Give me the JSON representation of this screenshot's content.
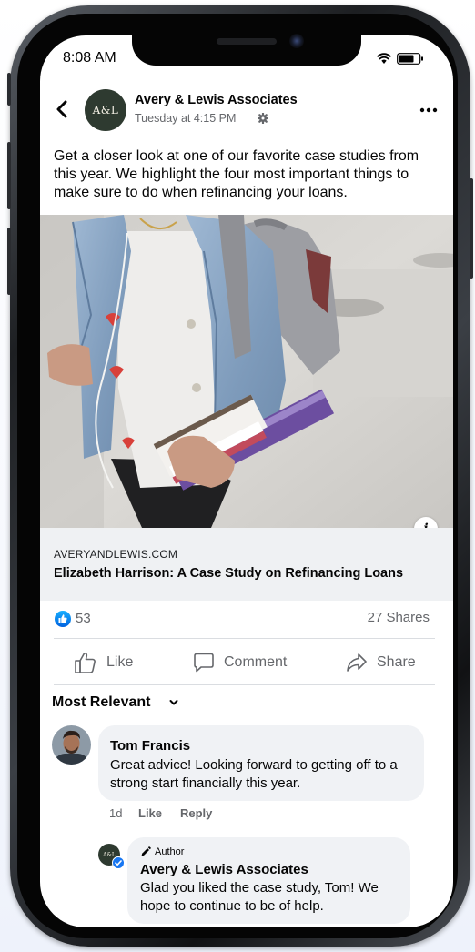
{
  "status_bar": {
    "time": "8:08 AM"
  },
  "post": {
    "page_initials": "A&L",
    "page_name": "Avery & Lewis Associates",
    "timestamp": "Tuesday at 4:15 PM",
    "text": "Get a closer look at one of our favorite case studies from this year. We highlight the four most important things to make sure to do when refinancing your loans.",
    "link": {
      "domain": "AVERYANDLEWIS.COM",
      "title": "Elizabeth Harrison: A Case Study on Refinancing Loans"
    },
    "reactions": {
      "like_count": "53",
      "shares": "27 Shares"
    },
    "actions": {
      "like": "Like",
      "comment": "Comment",
      "share": "Share"
    }
  },
  "comments": {
    "sort_label": "Most Relevant",
    "items": [
      {
        "name": "Tom Francis",
        "text": "Great advice! Looking forward to getting off to a strong start financially this year.",
        "age": "1d",
        "like": "Like",
        "reply": "Reply"
      }
    ],
    "reply": {
      "badge": "Author",
      "avatar_initials": "A&L",
      "name": "Avery & Lewis Associates",
      "text": "Glad you liked the case study, Tom! We hope to continue to be of help."
    }
  },
  "colors": {
    "facebook_blue": "#1877f2",
    "bubble_bg": "#f0f2f5",
    "secondary_text": "#65676b",
    "brand_green": "#2e3a30"
  }
}
